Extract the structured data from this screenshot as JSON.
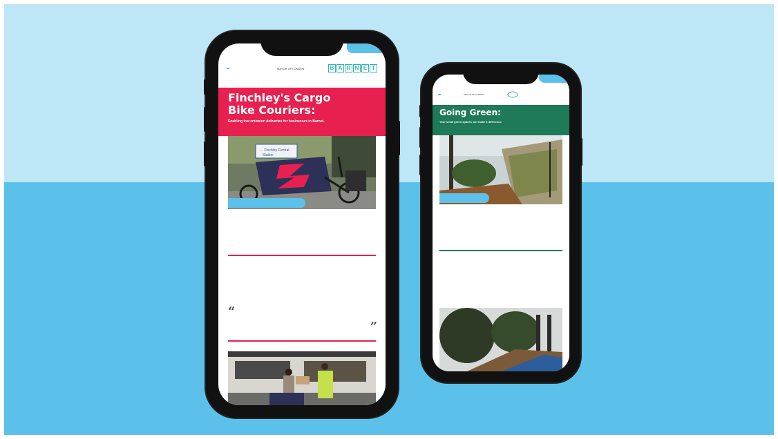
{
  "phone1": {
    "header": {
      "corner_label": "",
      "logo_left": "",
      "logo_mid_top": "",
      "logo_mid": "MAYOR OF LONDON",
      "logo_right": "BARNET",
      "logo_right_letters": [
        "B",
        "A",
        "R",
        "N",
        "E",
        "T"
      ]
    },
    "hero": {
      "title": "Finchley's Cargo Bike Couriers:",
      "subtitle": "Enabling low emission deliveries for businesses in Barnet."
    },
    "photo_caption": "",
    "paragraphs": [
      "",
      ""
    ],
    "quote": {
      "open": "“",
      "text": "",
      "attribution": "",
      "close": "”"
    }
  },
  "phone2": {
    "header": {
      "logo_left": "",
      "logo_mid": "MAYOR OF LONDON",
      "logo_right": ""
    },
    "hero": {
      "title": "Going Green:",
      "subtitle": "Your small green spaces can make a difference."
    },
    "photo_caption": "",
    "paragraphs": [
      "",
      "",
      "",
      ""
    ]
  },
  "colors": {
    "bg_top": "#bde6f7",
    "bg_bottom": "#5cc1ea",
    "hero1": "#e8204f",
    "hero2": "#1f7a57",
    "accent": "#5cc1ea",
    "teal": "#2fb5b0"
  }
}
